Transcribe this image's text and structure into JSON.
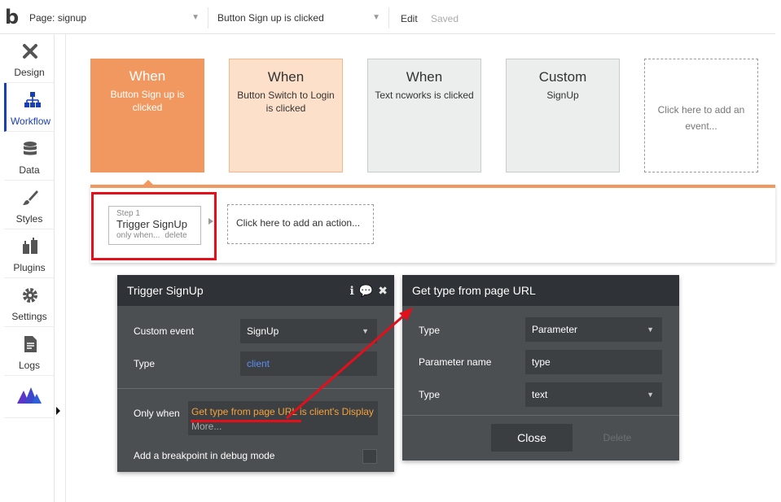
{
  "topbar": {
    "logo": "b",
    "page_select": "Page: signup",
    "event_select": "Button Sign up is clicked",
    "edit_label": "Edit",
    "saved_label": "Saved"
  },
  "sidebar": {
    "items": [
      {
        "label": "Design",
        "icon": "design-icon"
      },
      {
        "label": "Workflow",
        "icon": "workflow-icon",
        "active": true
      },
      {
        "label": "Data",
        "icon": "data-icon"
      },
      {
        "label": "Styles",
        "icon": "styles-icon"
      },
      {
        "label": "Plugins",
        "icon": "plugins-icon"
      },
      {
        "label": "Settings",
        "icon": "settings-icon"
      },
      {
        "label": "Logs",
        "icon": "logs-icon"
      },
      {
        "label": "",
        "icon": "bubble-logo-icon"
      }
    ]
  },
  "events": [
    {
      "heading": "When",
      "subtitle": "Button Sign up is clicked"
    },
    {
      "heading": "When",
      "subtitle": "Button Switch to Login is clicked"
    },
    {
      "heading": "When",
      "subtitle": "Text ncworks is clicked"
    },
    {
      "heading": "Custom",
      "subtitle": "SignUp"
    },
    {
      "heading": "",
      "subtitle": "Click here to add an event..."
    }
  ],
  "step": {
    "number": "Step 1",
    "title": "Trigger SignUp",
    "only_when": "only when...",
    "delete": "delete"
  },
  "add_action": "Click here to add an action...",
  "trigger_panel": {
    "title": "Trigger SignUp",
    "custom_event_label": "Custom event",
    "custom_event_value": "SignUp",
    "type_label": "Type",
    "type_value": "client",
    "only_when_label": "Only when",
    "only_when_expression": "Get type from page URL is client's Display",
    "only_when_more": "More...",
    "breakpoint_label": "Add a breakpoint in debug mode"
  },
  "url_panel": {
    "title": "Get type from page URL",
    "type_label": "Type",
    "type_value": "Parameter",
    "param_name_label": "Parameter name",
    "param_name_value": "type",
    "type2_label": "Type",
    "type2_value": "text",
    "close_label": "Close",
    "delete_label": "Delete"
  },
  "colors": {
    "active_event": "#f0985f",
    "highlight": "#e30f1b",
    "panel": "#4c4f52",
    "panel_header": "#2f3236",
    "workflow_active": "#1a3fb5",
    "expression": "#f4a23c"
  }
}
